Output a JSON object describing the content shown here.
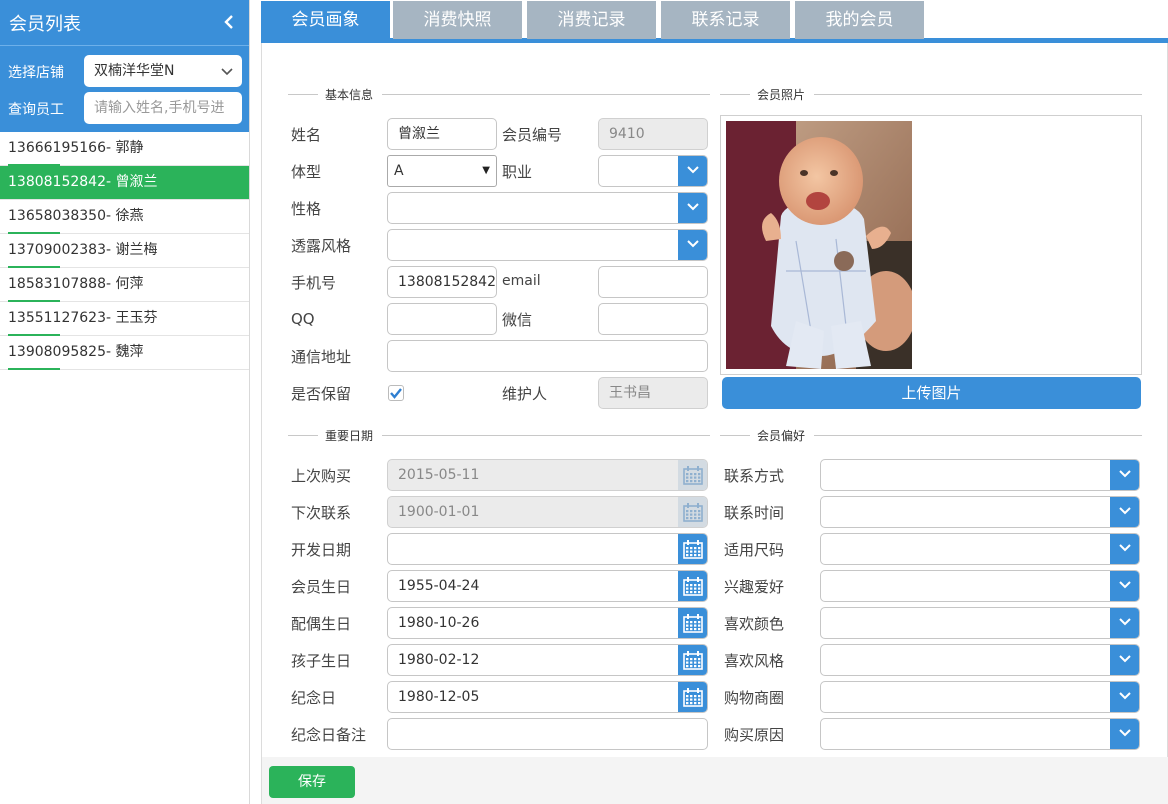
{
  "sidebar": {
    "title": "会员列表",
    "store_label": "选择店铺",
    "store_value": "双楠洋华堂N",
    "employee_label": "查询员工",
    "employee_placeholder": "请输入姓名,手机号进",
    "members": [
      {
        "phone": "13666195166",
        "name": "郭静",
        "display": "13666195166- 郭静"
      },
      {
        "phone": "13808152842",
        "name": "曾溆兰",
        "display": "13808152842- 曾溆兰"
      },
      {
        "phone": "13658038350",
        "name": "徐燕",
        "display": "13658038350- 徐燕"
      },
      {
        "phone": "13709002383",
        "name": "谢兰梅",
        "display": "13709002383- 谢兰梅"
      },
      {
        "phone": "18583107888",
        "name": "何萍",
        "display": "18583107888- 何萍"
      },
      {
        "phone": "13551127623",
        "name": "王玉芬",
        "display": "13551127623- 王玉芬"
      },
      {
        "phone": "13908095825",
        "name": "魏萍",
        "display": "13908095825- 魏萍"
      }
    ],
    "selected_index": 1
  },
  "tabs": [
    {
      "label": "会员画象",
      "active": true
    },
    {
      "label": "消费快照",
      "active": false
    },
    {
      "label": "消费记录",
      "active": false
    },
    {
      "label": "联系记录",
      "active": false
    },
    {
      "label": "我的会员",
      "active": false
    }
  ],
  "basic_info": {
    "section_title": "基本信息",
    "name_label": "姓名",
    "name_value": "曾溆兰",
    "member_no_label": "会员编号",
    "member_no_value": "9410",
    "body_type_label": "体型",
    "body_type_value": "A",
    "occupation_label": "职业",
    "occupation_value": "",
    "personality_label": "性格",
    "personality_value": "",
    "style_label": "透露风格",
    "style_value": "",
    "phone_label": "手机号",
    "phone_value": "13808152842",
    "email_label": "email",
    "email_value": "",
    "qq_label": "QQ",
    "qq_value": "",
    "wechat_label": "微信",
    "wechat_value": "",
    "address_label": "通信地址",
    "address_value": "",
    "reserve_label": "是否保留",
    "reserve_checked": true,
    "maintainer_label": "维护人",
    "maintainer_value": "王书昌"
  },
  "photo": {
    "section_title": "会员照片",
    "upload_label": "上传图片"
  },
  "dates": {
    "section_title": "重要日期",
    "items": [
      {
        "label": "上次购买",
        "value": "2015-05-11",
        "disabled": true
      },
      {
        "label": "下次联系",
        "value": "1900-01-01",
        "disabled": true
      },
      {
        "label": "开发日期",
        "value": "",
        "disabled": false
      },
      {
        "label": "会员生日",
        "value": "1955-04-24",
        "disabled": false
      },
      {
        "label": "配偶生日",
        "value": "1980-10-26",
        "disabled": false
      },
      {
        "label": "孩子生日",
        "value": "1980-02-12",
        "disabled": false
      },
      {
        "label": "纪念日",
        "value": "1980-12-05",
        "disabled": false
      }
    ],
    "note_label": "纪念日备注",
    "note_value": ""
  },
  "preferences": {
    "section_title": "会员偏好",
    "items": [
      {
        "label": "联系方式",
        "value": ""
      },
      {
        "label": "联系时间",
        "value": ""
      },
      {
        "label": "适用尺码",
        "value": ""
      },
      {
        "label": "兴趣爱好",
        "value": ""
      },
      {
        "label": "喜欢颜色",
        "value": ""
      },
      {
        "label": "喜欢风格",
        "value": ""
      },
      {
        "label": "购物商圈",
        "value": ""
      },
      {
        "label": "购买原因",
        "value": ""
      }
    ]
  },
  "footer": {
    "save_label": "保存"
  },
  "colors": {
    "primary": "#3a8fd9",
    "success": "#2bb35a",
    "tab_inactive": "#a6b5c2"
  },
  "icons": {
    "collapse": "chevron-left-icon",
    "select": "chevron-down-icon",
    "calendar": "calendar-icon",
    "check": "checkmark-icon"
  }
}
